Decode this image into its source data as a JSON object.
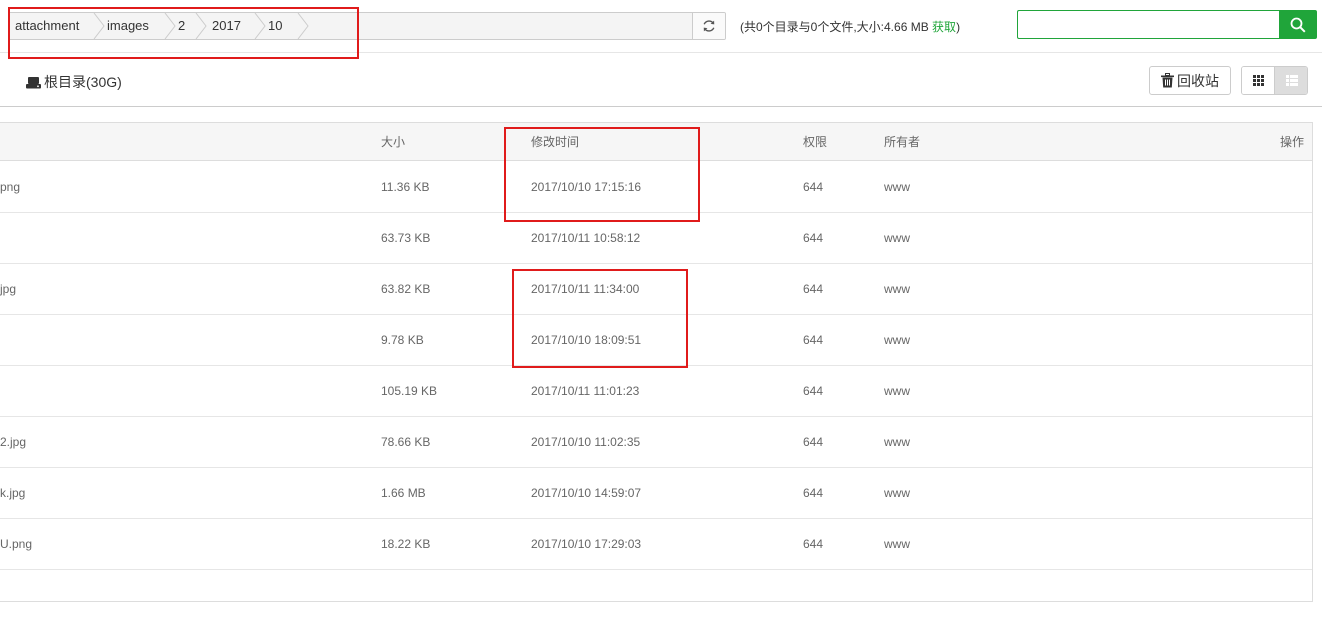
{
  "breadcrumb": [
    "attachment",
    "images",
    "2",
    "2017",
    "10"
  ],
  "dir_info": {
    "prefix": "(共0个目录与0个文件,大小:4.66 MB ",
    "fetch_label": "获取",
    "suffix": ")"
  },
  "search": {
    "value": "",
    "placeholder": ""
  },
  "root": {
    "label": "根目录(30G)"
  },
  "recycle": {
    "label": "回收站"
  },
  "table": {
    "headers": {
      "size": "大小",
      "mtime": "修改时间",
      "perm": "权限",
      "owner": "所有者",
      "ops": "操作"
    },
    "rows": [
      {
        "name": "png",
        "size": "11.36 KB",
        "mtime": "2017/10/10 17:15:16",
        "perm": "644",
        "owner": "www"
      },
      {
        "name": "",
        "size": "63.73 KB",
        "mtime": "2017/10/11 10:58:12",
        "perm": "644",
        "owner": "www"
      },
      {
        "name": "jpg",
        "size": "63.82 KB",
        "mtime": "2017/10/11 11:34:00",
        "perm": "644",
        "owner": "www"
      },
      {
        "name": "",
        "size": "9.78 KB",
        "mtime": "2017/10/10 18:09:51",
        "perm": "644",
        "owner": "www"
      },
      {
        "name": "",
        "size": "105.19 KB",
        "mtime": "2017/10/11 11:01:23",
        "perm": "644",
        "owner": "www"
      },
      {
        "name": "2.jpg",
        "size": "78.66 KB",
        "mtime": "2017/10/10 11:02:35",
        "perm": "644",
        "owner": "www"
      },
      {
        "name": "k.jpg",
        "size": "1.66 MB",
        "mtime": "2017/10/10 14:59:07",
        "perm": "644",
        "owner": "www"
      },
      {
        "name": "U.png",
        "size": "18.22 KB",
        "mtime": "2017/10/10 17:29:03",
        "perm": "644",
        "owner": "www"
      }
    ]
  },
  "colors": {
    "accent": "#20a53a",
    "annotation": "#e01b1b"
  },
  "icons": [
    "refresh-icon",
    "search-icon",
    "disk-icon",
    "trash-icon",
    "grid-view-icon",
    "list-view-icon"
  ]
}
